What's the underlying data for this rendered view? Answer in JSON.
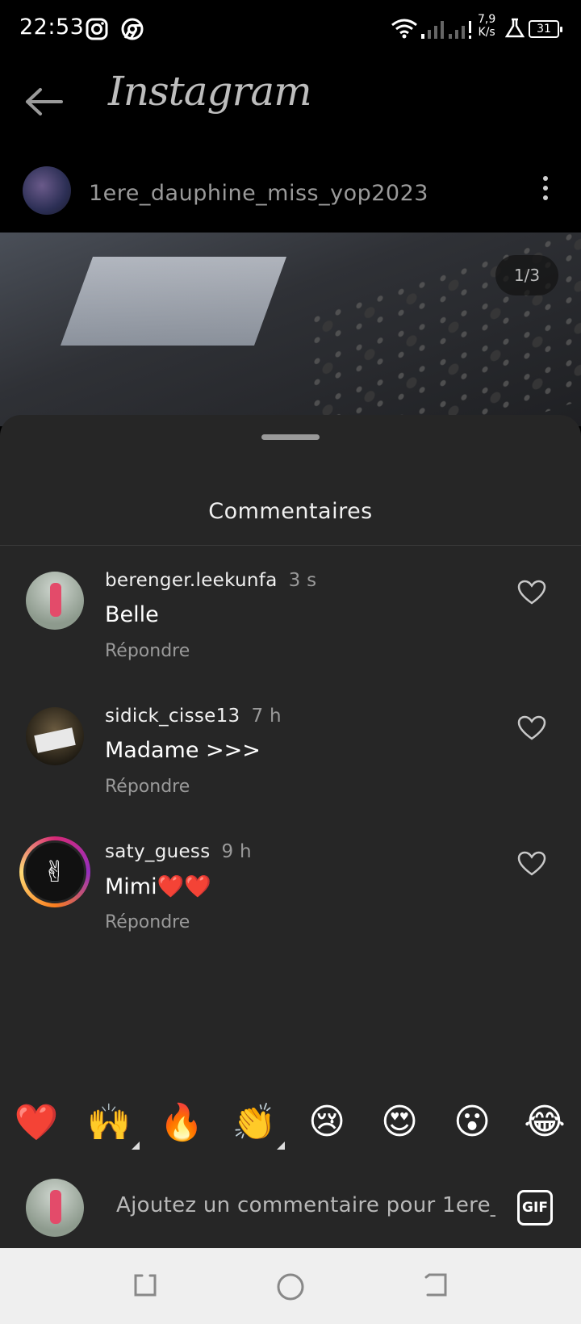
{
  "status_bar": {
    "time": "22:53",
    "speed_value": "7,9",
    "speed_unit": "K/s",
    "battery": "31",
    "icons": [
      "instagram-icon",
      "chrome-icon",
      "wifi-icon",
      "signal-icon",
      "signal-icon",
      "flask-icon",
      "battery-icon"
    ]
  },
  "header": {
    "app_title": "Instagram",
    "back_icon": "back-arrow-icon"
  },
  "post": {
    "username": "1ere_dauphine_miss_yop2023",
    "pager": "1/3",
    "more_icon": "more-vertical-icon"
  },
  "comments_sheet": {
    "title": "Commentaires",
    "comments": [
      {
        "user": "berenger.leekunfa",
        "time": "3 s",
        "text": "Belle",
        "reply": "Répondre"
      },
      {
        "user": "sidick_cisse13",
        "time": "7 h",
        "text": "Madame >>>",
        "reply": "Répondre"
      },
      {
        "user": "saty_guess",
        "time": "9 h",
        "text": "Mimi❤️❤️",
        "reply": "Répondre"
      }
    ]
  },
  "quick_reactions": [
    "❤️",
    "🙌",
    "🔥",
    "👏",
    "😢",
    "😍",
    "😮",
    "😂"
  ],
  "composer": {
    "placeholder": "Ajoutez un commentaire pour 1ere_d",
    "gif_label": "GIF"
  },
  "colors": {
    "sheet_bg": "#262626",
    "story_ring": "#d62976",
    "nav_bar_bg": "#efefef"
  }
}
